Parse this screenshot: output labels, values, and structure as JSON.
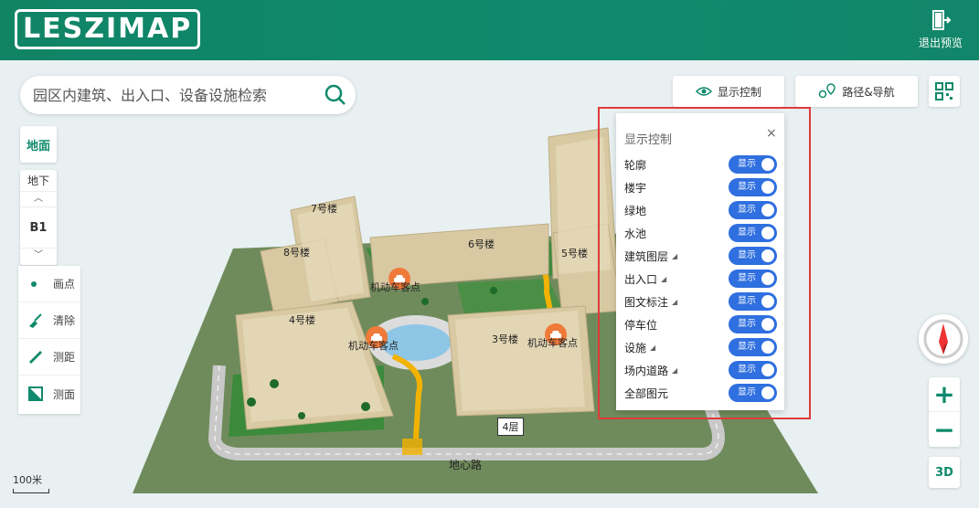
{
  "header": {
    "logo_text": "LESZIMAP",
    "exit_label": "退出预览"
  },
  "search": {
    "placeholder": "园区内建筑、出入口、设备设施检索"
  },
  "toolbar": {
    "display_control_label": "显示控制",
    "route_nav_label": "路径&导航"
  },
  "floors": {
    "ground_label": "地面",
    "underground_label": "地下",
    "current_label": "B1"
  },
  "tools": [
    {
      "label": "画点",
      "icon": "dot-icon"
    },
    {
      "label": "清除",
      "icon": "broom-icon"
    },
    {
      "label": "测距",
      "icon": "ruler-icon"
    },
    {
      "label": "测面",
      "icon": "area-icon"
    }
  ],
  "panel": {
    "title": "显示控制",
    "close_symbol": "×",
    "toggle_text": "显示",
    "rows": [
      {
        "label": "轮廓",
        "expandable": false
      },
      {
        "label": "楼宇",
        "expandable": false
      },
      {
        "label": "绿地",
        "expandable": false
      },
      {
        "label": "水池",
        "expandable": false
      },
      {
        "label": "建筑图层",
        "expandable": true
      },
      {
        "label": "出入口",
        "expandable": true
      },
      {
        "label": "图文标注",
        "expandable": true
      },
      {
        "label": "停车位",
        "expandable": false
      },
      {
        "label": "设施",
        "expandable": true
      },
      {
        "label": "场内道路",
        "expandable": true
      },
      {
        "label": "全部图元",
        "expandable": false
      }
    ]
  },
  "map": {
    "buildings": [
      "7号楼",
      "8号楼",
      "4号楼",
      "6号楼",
      "5号楼",
      "3号楼"
    ],
    "poi_label": "机动车客点",
    "floor_tag": "4层",
    "road_label": "地心路",
    "scale_label": "100米"
  },
  "controls": {
    "zoom_in": "+",
    "zoom_out": "−",
    "mode_3d": "3D"
  },
  "colors": {
    "brand": "#0f8a6c",
    "toggle_on": "#2f6fe0",
    "highlight_box": "#e03a3a",
    "poi": "#ef7a3a"
  }
}
